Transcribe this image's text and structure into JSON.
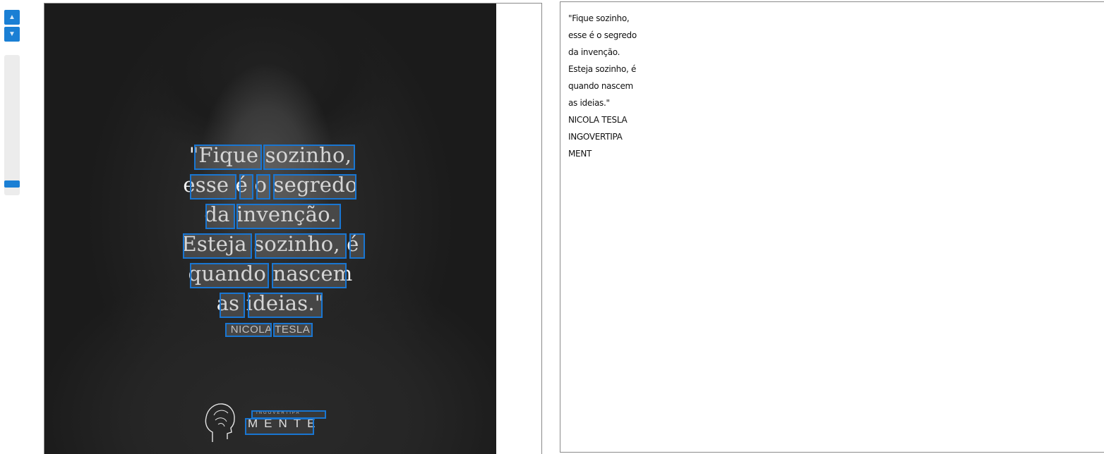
{
  "toolbar": {
    "zoom_in_icon": "chevron-up-icon",
    "zoom_out_icon": "chevron-down-icon",
    "zoom_level_fraction": 0.93,
    "accent_color": "#1a7fd4"
  },
  "image": {
    "quote_lines": [
      "\"Fique sozinho,",
      "esse é o segredo",
      "da invenção.",
      "Esteja sozinho, é",
      "quando nascem",
      "as ideias.\""
    ],
    "author": "NICOLA TESLA",
    "logo_tagline": "INGOVERTIPA",
    "logo_word": "MENTE",
    "box_color": "#1976d2"
  },
  "output": {
    "lines": [
      "\"Fique sozinho,",
      "esse é o segredo",
      "da invenção.",
      "Esteja sozinho, é",
      "quando nascem",
      "as ideias.\"",
      "NICOLA TESLA",
      "INGOVERTIPA",
      "MENT"
    ]
  }
}
